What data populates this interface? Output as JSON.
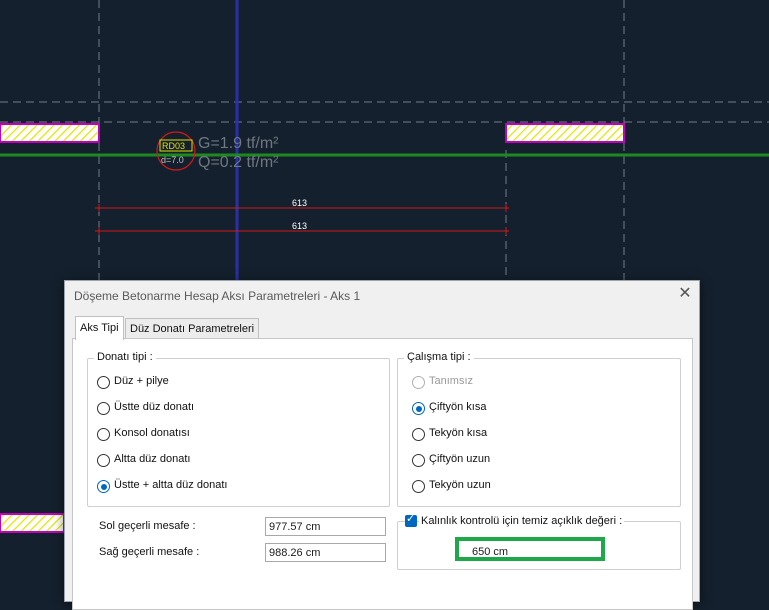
{
  "cad": {
    "slab_label": "RD03",
    "slab_thickness": "d=7.0",
    "load_g": "G=1.9 tf/m²",
    "load_q": "Q=0.2 tf/m²",
    "dim_top": "613",
    "dim_bottom": "613",
    "colors": {
      "background": "#14202d",
      "axis_blue": "#2b2fa8",
      "green_line": "#1e8a1e",
      "dim_red": "#d11a1a",
      "hatch": "#c000c0"
    }
  },
  "dialog": {
    "title": "Döşeme Betonarme Hesap Aksı Parametreleri - Aks 1",
    "close_icon": "close-icon",
    "tabs": [
      "Aks Tipi",
      "Düz Donatı Parametreleri"
    ],
    "active_tab": "Aks Tipi",
    "donati": {
      "legend": "Donatı tipi :",
      "options": [
        "Düz + pilye",
        "Üstte düz donatı",
        "Konsol donatısı",
        "Altta düz donatı",
        "Üstte + altta düz donatı"
      ],
      "selected": "Üstte + altta düz donatı"
    },
    "calisma": {
      "legend": "Çalışma tipi :",
      "options": [
        "Tanımsız",
        "Çiftyön kısa",
        "Tekyön kısa",
        "Çiftyön uzun",
        "Tekyön uzun"
      ],
      "selected": "Çiftyön kısa",
      "disabled": [
        "Tanımsız"
      ]
    },
    "sol_label": "Sol geçerli mesafe :",
    "sol_value": "977.57 cm",
    "sag_label": "Sağ geçerli mesafe :",
    "sag_value": "988.26 cm",
    "kalinlik_label": "Kalınlık kontrolü için temiz açıklık değeri :",
    "kalinlik_checked": true,
    "kalinlik_value": "650 cm",
    "accent": "#0067c0",
    "highlight": "#1fa84a"
  }
}
